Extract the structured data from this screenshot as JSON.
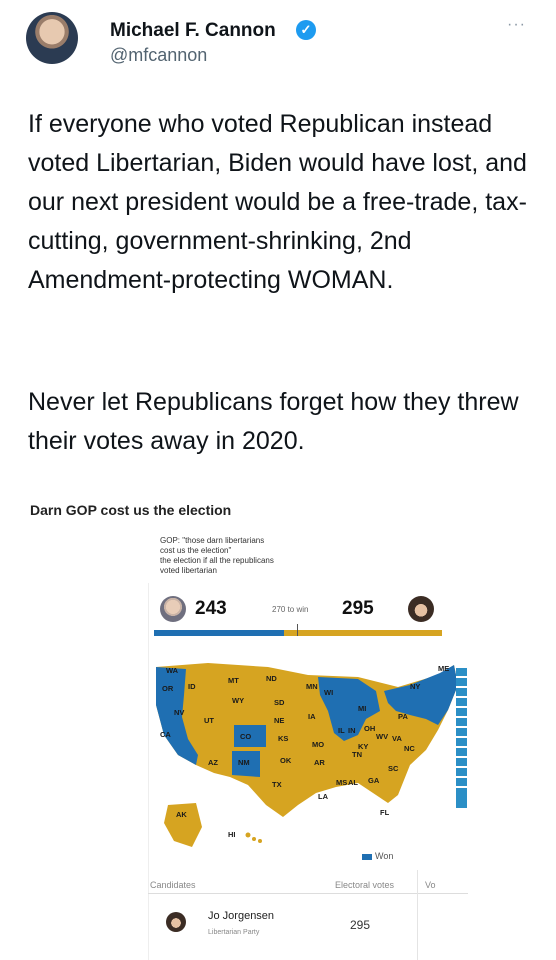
{
  "tweet": {
    "author_name": "Michael F. Cannon",
    "verified_mark": "✓",
    "handle": "@mfcannon",
    "more_label": "···",
    "paragraph_1": "If everyone who voted Republican instead voted Libertarian, Biden would have lost, and our next president would be a free-trade, tax-cutting, government-shrinking, 2nd Amendment-protecting WOMAN.",
    "paragraph_2": "Never let Republicans forget how they threw their votes away in 2020."
  },
  "image": {
    "title": "Darn GOP cost us the election",
    "quote_lines": [
      "GOP: \"those darn libertarians",
      "cost us the election\"",
      "the election if all the republicans",
      "voted libertarian"
    ],
    "tally": {
      "left_count": "243",
      "to_win_label": "270 to win",
      "right_count": "295",
      "left_share": 0.452
    },
    "map": {
      "state_labels": [
        "WA",
        "OR",
        "ID",
        "MT",
        "ND",
        "MN",
        "WI",
        "MI",
        "NY",
        "ME",
        "NV",
        "CA",
        "UT",
        "WY",
        "SD",
        "NE",
        "IA",
        "IL",
        "IN",
        "OH",
        "PA",
        "WV",
        "CO",
        "KS",
        "MO",
        "KY",
        "VA",
        "NC",
        "TN",
        "AZ",
        "NM",
        "OK",
        "AR",
        "SC",
        "TX",
        "MS",
        "AL",
        "GA",
        "LA",
        "FL",
        "AK",
        "HI"
      ],
      "colors": {
        "blue": "#1f6fb2",
        "gold": "#d6a421"
      }
    },
    "legend": "Won",
    "table": {
      "header_candidates": "Candidates",
      "header_electoral": "Electoral votes",
      "header_cut": "Vo",
      "row_name": "Jo Jorgensen",
      "row_party": "Libertarian Party",
      "row_votes": "295"
    }
  }
}
